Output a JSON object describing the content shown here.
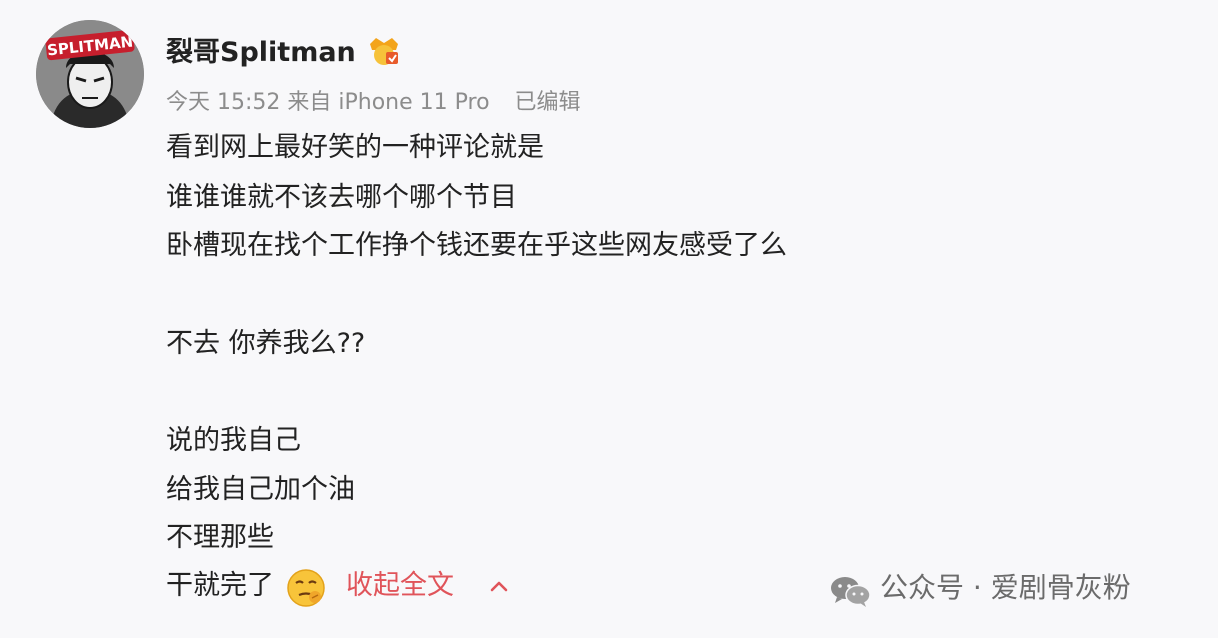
{
  "post": {
    "username": "裂哥Splitman",
    "time": "今天 15:52",
    "source": "来自 iPhone 11 Pro",
    "edited": "已编辑",
    "badge_icon": "vip-crown-badge-icon",
    "lines": [
      "看到网上最好笑的一种评论就是",
      "谁谁谁就不该去哪个哪个节目",
      "卧槽现在找个工作挣个钱还要在乎这些网友感受了么",
      "不去 你养我么??",
      "说的我自己",
      "给我自己加个油",
      "不理那些",
      "干就完了"
    ],
    "collapse_label": "收起全文",
    "emoji_icon": "smirk-emoji-icon",
    "collapse_icon": "chevron-up-icon",
    "avatar_text": "SPLITMAN"
  },
  "watermark": {
    "text": "公众号 · 爱剧骨灰粉",
    "icon": "wechat-icon"
  },
  "colors": {
    "link": "#e0545a",
    "meta": "#8c8c8c",
    "text": "#222222"
  }
}
